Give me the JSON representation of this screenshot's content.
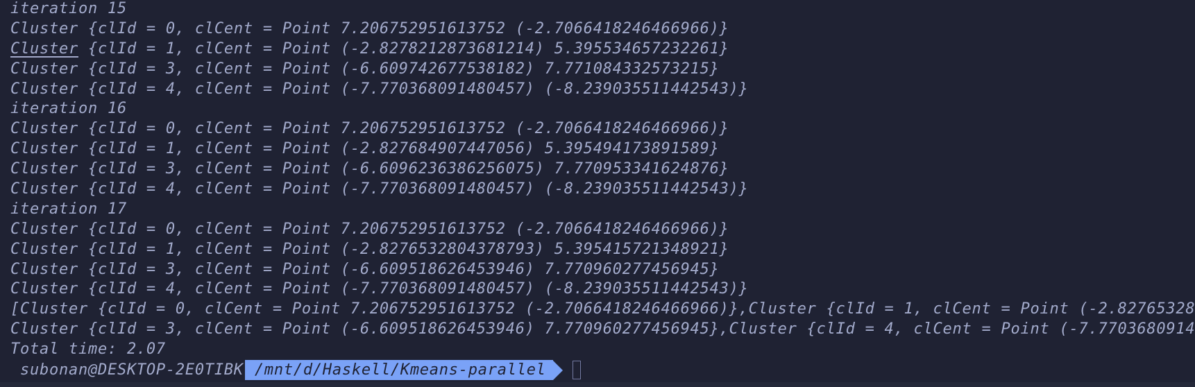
{
  "terminal": {
    "lines": [
      "iteration 15",
      "Cluster {clId = 0, clCent = Point 7.206752951613752 (-2.7066418246466966)}",
      " {clId = 1, clCent = Point (-2.8278212873681214) 5.395534657232261}",
      "Cluster {clId = 3, clCent = Point (-6.609742677538182) 7.771084332573215}",
      "Cluster {clId = 4, clCent = Point (-7.770368091480457) (-8.239035511442543)}",
      "iteration 16",
      "Cluster {clId = 0, clCent = Point 7.206752951613752 (-2.7066418246466966)}",
      "Cluster {clId = 1, clCent = Point (-2.827684907447056) 5.395494173891589}",
      "Cluster {clId = 3, clCent = Point (-6.6096236386256075) 7.770953341624876}",
      "Cluster {clId = 4, clCent = Point (-7.770368091480457) (-8.239035511442543)}",
      "iteration 17",
      "Cluster {clId = 0, clCent = Point 7.206752951613752 (-2.7066418246466966)}",
      "Cluster {clId = 1, clCent = Point (-2.8276532804378793) 5.395415721348921}",
      "Cluster {clId = 3, clCent = Point (-6.609518626453946) 7.770960277456945}",
      "Cluster {clId = 4, clCent = Point (-7.770368091480457) (-8.239035511442543)}",
      "[Cluster {clId = 0, clCent = Point 7.206752951613752 (-2.7066418246466966)},Cluster {clId = 1, clCent = Point (-2.82765328",
      "Cluster {clId = 3, clCent = Point (-6.609518626453946) 7.770960277456945},Cluster {clId = 4, clCent = Point (-7.7703680914",
      "Total time: 2.07"
    ],
    "underlined_word": "Cluster"
  },
  "prompt": {
    "user_host": " subonan@DESKTOP-2E0TIBK",
    "path": "/mnt/d/Haskell/Kmeans-parallel"
  },
  "colors": {
    "background": "#1f2233",
    "text": "#a3abcc",
    "path_segment": "#7aa2f7"
  }
}
